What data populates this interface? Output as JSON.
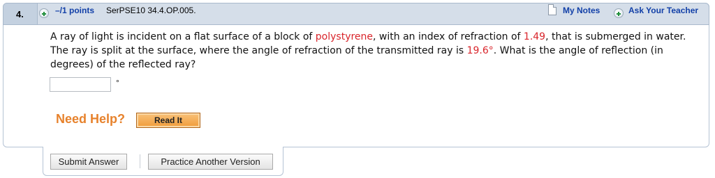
{
  "question": {
    "number": "4.",
    "points": "–/1 points",
    "id": "SerPSE10 34.4.OP.005."
  },
  "header_links": {
    "my_notes": "My Notes",
    "ask_teacher": "Ask Your Teacher"
  },
  "text": {
    "p1": "A ray of light is incident on a flat surface of a block of ",
    "material": "polystyrene",
    "p2": ", with an index of refraction of ",
    "index": "1.49",
    "p3": ", that is submerged in water. The ray is split at the surface, where the angle of refraction of the transmitted ray is ",
    "angle": "19.6°",
    "p4": ". What is the angle of reflection (in degrees) of the reflected ray?"
  },
  "answer": {
    "value": "",
    "unit": "°"
  },
  "help": {
    "label": "Need Help?",
    "read_it": "Read It"
  },
  "actions": {
    "submit": "Submit Answer",
    "practice": "Practice Another Version"
  },
  "colors": {
    "highlight": "#d9252b",
    "link": "#1240a8",
    "need_help": "#e7822c",
    "header_bg": "#d5dee9"
  }
}
